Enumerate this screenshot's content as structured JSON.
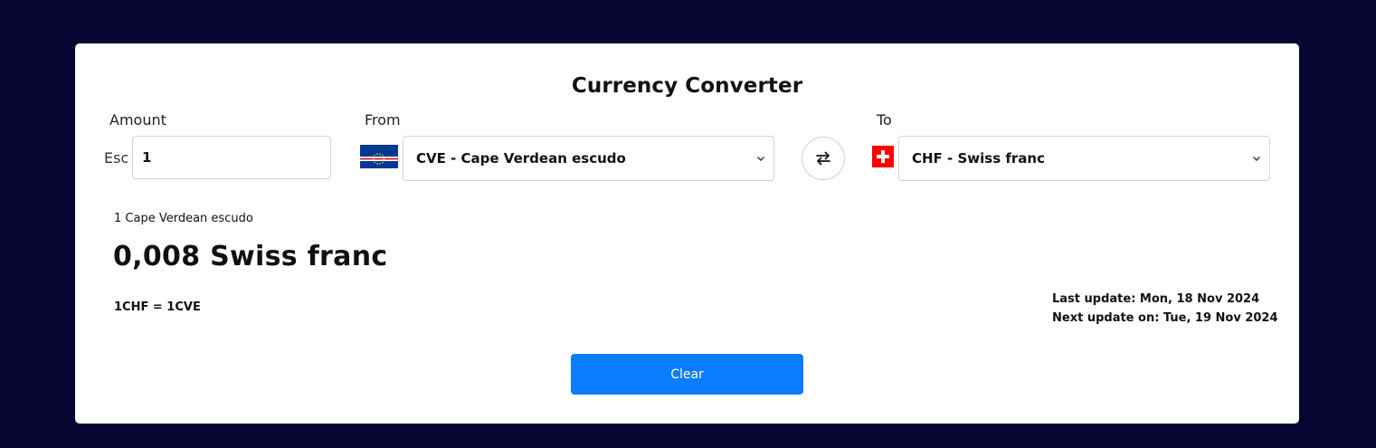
{
  "converter": {
    "title": "Currency Converter",
    "amount_label": "Amount",
    "from_label": "From",
    "to_label": "To",
    "amount_prefix": "Esc",
    "amount_value": "1",
    "from_currency": "CVE - Cape Verdean escudo",
    "to_currency": "CHF - Swiss franc",
    "from_flag_icon": "cape-verde-flag-icon",
    "to_flag_icon": "switzerland-flag-icon",
    "swap_icon": "swap-arrows-icon"
  },
  "result": {
    "from_description": "1 Cape Verdean escudo",
    "converted_value": "0,008 Swiss franc",
    "rate_text": "1CHF = 1CVE",
    "last_update": "Last update: Mon, 18 Nov 2024",
    "next_update": "Next update on: Tue, 19 Nov 2024"
  },
  "actions": {
    "clear_label": "Clear"
  },
  "colors": {
    "background": "#070632",
    "card": "#ffffff",
    "accent": "#0a7cff"
  }
}
